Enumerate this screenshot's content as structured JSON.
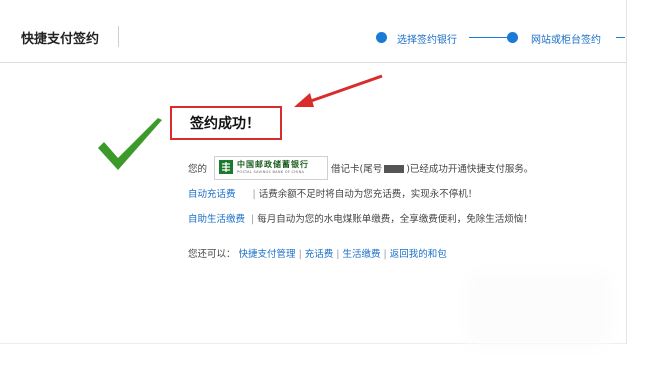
{
  "header": {
    "title": "快捷支付签约",
    "steps": [
      "选择签约银行",
      "网站或柜台签约"
    ]
  },
  "success": {
    "title": "签约成功！"
  },
  "bank": {
    "prefix": "您的",
    "name": "中国邮政储蓄银行",
    "name_en": "POSTAL SAVINGS BANK OF CHINA",
    "card_text_pre": "借记卡(尾号",
    "card_text_post": ")已经成功开通快捷支付服务。"
  },
  "services": [
    {
      "link": "自动充话费",
      "desc": "话费余额不足时将自动为您充话费，实现永不停机！"
    },
    {
      "link": "自助生活缴费",
      "desc": "每月自动为您的水电煤账单缴费，全享缴费便利，免除生活烦恼！"
    }
  ],
  "more": {
    "label": "您还可以：",
    "links": [
      "快捷支付管理",
      "充话费",
      "生活缴费",
      "返回我的和包"
    ]
  },
  "colors": {
    "accent": "#1a7ad6",
    "check": "#3c9a2a",
    "alert": "#d92c2c"
  }
}
